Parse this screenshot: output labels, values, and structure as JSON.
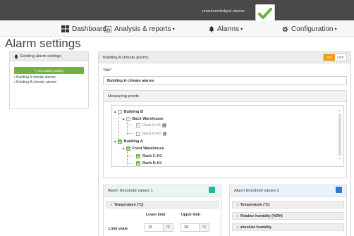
{
  "topbar": {
    "notification_text": "unacknowledged alarms.",
    "check_color": "#6cb33f"
  },
  "nav": {
    "dashboard": "Dashboard",
    "analysis": "Analysis & reports",
    "alarms": "Alarms",
    "configuration": "Configuration"
  },
  "page": {
    "title": "Alarm settings"
  },
  "left_panel": {
    "header": "Existing alarm settings",
    "new_button": "+ New alarm setting",
    "items": [
      {
        "label": "Building A climate alarms"
      },
      {
        "label": "Building B climatic alarms"
      }
    ]
  },
  "main_panel": {
    "header": "Building A climate alarms",
    "toggle_on": "ON",
    "toggle_off": "OFF",
    "title_label": "Title*",
    "title_value": "Building A climate alarms"
  },
  "measuring_points": {
    "header": "Measuring points",
    "tree": {
      "building_b": "Building B",
      "back_warehouse": "Back Warehouse",
      "rack_a": "Rack A-H1",
      "rack_b": "Rack B-H1",
      "building_a": "Building A",
      "front_warehouse": "Front Warehouse",
      "rack_c": "Rack C-H1",
      "rack_d": "Rack D-H1"
    }
  },
  "threshold1": {
    "header": "Alarm threshold values 1",
    "color": "#1abc9c",
    "category": "Temperature (°C)",
    "lower_limit_label": "Lower limit",
    "upper_limit_label": "Upper limit",
    "limit_value_label": "Limit value",
    "lower_value": "15",
    "upper_value": "28",
    "unit": "°C"
  },
  "threshold2": {
    "header": "Alarm threshold values 2",
    "color": "#2a7ac8",
    "categories": [
      {
        "label": "Temperature (°C)"
      },
      {
        "label": "Relative humidity (%RH)"
      },
      {
        "label": "absolute humidity"
      }
    ]
  }
}
